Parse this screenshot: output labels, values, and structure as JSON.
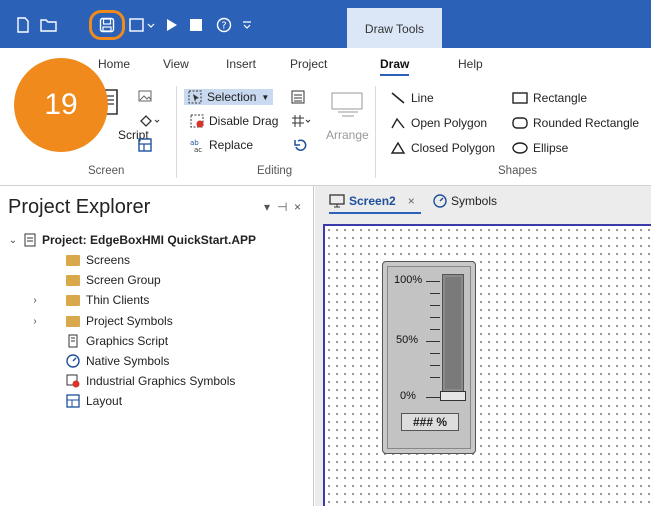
{
  "titlebar": {
    "contextual_tab": "Draw Tools",
    "quick_access": [
      "new-file-icon",
      "open-folder-icon",
      "save-icon",
      "new-screen-icon",
      "run-icon",
      "stop-icon",
      "help-icon",
      "customize-arrow-icon"
    ]
  },
  "ribbon": {
    "tabs": [
      "Home",
      "View",
      "Insert",
      "Project",
      "Draw",
      "Help"
    ],
    "active_tab": "Draw",
    "groups": {
      "screen": {
        "label": "Screen",
        "script_label": "Script"
      },
      "editing": {
        "label": "Editing",
        "selection": "Selection",
        "disable_drag": "Disable Drag",
        "replace": "Replace",
        "arrange": "Arrange"
      },
      "shapes": {
        "label": "Shapes",
        "line": "Line",
        "rectangle": "Rectangle",
        "open_polygon": "Open Polygon",
        "rounded_rectangle": "Rounded Rectangle",
        "closed_polygon": "Closed Polygon",
        "ellipse": "Ellipse"
      }
    }
  },
  "step_badge": "19",
  "explorer": {
    "title": "Project Explorer",
    "pin": "⊣",
    "close": "×",
    "dropdown": "▾",
    "tree": [
      {
        "label": "Project: EdgeBoxHMI QuickStart.APP",
        "bold": true
      },
      {
        "label": "Screens"
      },
      {
        "label": "Screen Group"
      },
      {
        "label": "Thin Clients"
      },
      {
        "label": "Project Symbols"
      },
      {
        "label": "Graphics Script"
      },
      {
        "label": "Native Symbols"
      },
      {
        "label": "Industrial Graphics Symbols"
      },
      {
        "label": "Layout"
      }
    ]
  },
  "editor": {
    "tabs": [
      {
        "label": "Screen2",
        "close": "×"
      },
      {
        "label": "Symbols"
      }
    ],
    "widget": {
      "top": "100%",
      "mid": "50%",
      "bottom": "0%",
      "readout": "### %"
    }
  },
  "colors": {
    "accent": "#2b62b8",
    "badge": "#f08a1c"
  }
}
